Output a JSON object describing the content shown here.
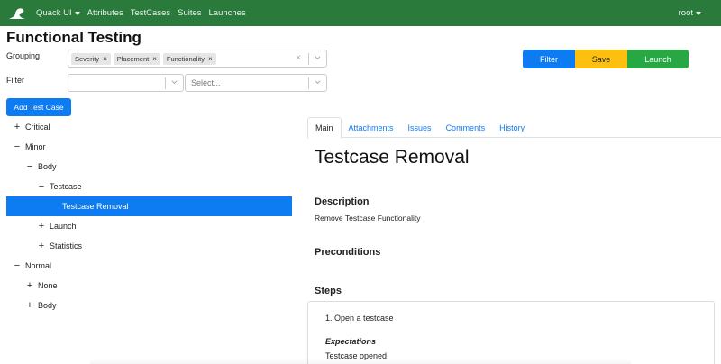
{
  "navbar": {
    "brand": "Quack UI",
    "items": [
      "Attributes",
      "TestCases",
      "Suites",
      "Launches"
    ],
    "user": "root",
    "color": "#2a7a3b"
  },
  "page_title": "Functional Testing",
  "grouping": {
    "label": "Grouping",
    "chips": [
      "Severity",
      "Placement",
      "Functionality"
    ]
  },
  "filter": {
    "label": "Filter",
    "second_placeholder": "Select..."
  },
  "actions": {
    "filter": "Filter",
    "save": "Save",
    "launch": "Launch"
  },
  "add_test_case": "Add Test Case",
  "tree": {
    "critical": {
      "sign": "+",
      "label": "Critical"
    },
    "minor": {
      "sign": "−",
      "label": "Minor"
    },
    "body": {
      "sign": "−",
      "label": "Body"
    },
    "testcase": {
      "sign": "−",
      "label": "Testcase"
    },
    "selected": {
      "label": "Testcase Removal"
    },
    "launch": {
      "sign": "+",
      "label": "Launch"
    },
    "statistics": {
      "sign": "+",
      "label": "Statistics"
    },
    "normal": {
      "sign": "−",
      "label": "Normal"
    },
    "none": {
      "sign": "+",
      "label": "None"
    },
    "body2": {
      "sign": "+",
      "label": "Body"
    }
  },
  "tabs": [
    "Main",
    "Attachments",
    "Issues",
    "Comments",
    "History"
  ],
  "testcase": {
    "title": "Testcase Removal",
    "description_heading": "Description",
    "description": "Remove Testcase Functionality",
    "preconditions_heading": "Preconditions",
    "steps_heading": "Steps",
    "step1": "1. Open a testcase",
    "expectations_heading": "Expectations",
    "expectation1": "Testcase opened"
  },
  "colors": {
    "primary": "#0d7bf2",
    "warning": "#fdc00f",
    "success": "#28a745"
  }
}
